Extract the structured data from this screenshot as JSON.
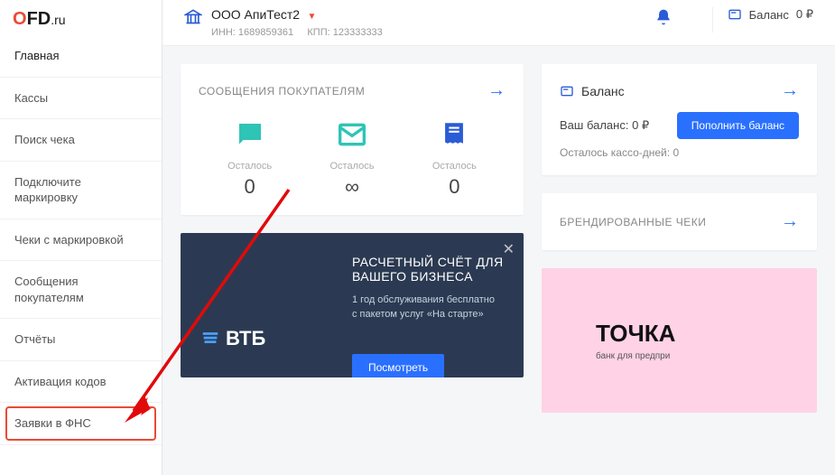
{
  "logo": {
    "text": "OFD",
    "suffix": ".ru"
  },
  "sidebar": {
    "items": [
      {
        "label": "Главная"
      },
      {
        "label": "Кассы"
      },
      {
        "label": "Поиск чека"
      },
      {
        "label": "Подключите маркировку"
      },
      {
        "label": "Чеки с маркировкой"
      },
      {
        "label": "Сообщения покупателям"
      },
      {
        "label": "Отчёты"
      },
      {
        "label": "Активация кодов"
      },
      {
        "label": "Заявки в ФНС"
      }
    ]
  },
  "header": {
    "org_name": "ООО АпиТест2",
    "inn_label": "ИНН:",
    "inn": "1689859361",
    "kpp_label": "КПП:",
    "kpp": "123333333",
    "balance_label": "Баланс",
    "balance_value": "0 ₽"
  },
  "messages_card": {
    "title": "СООБЩЕНИЯ ПОКУПАТЕЛЯМ",
    "items": [
      {
        "label": "Осталось",
        "value": "0"
      },
      {
        "label": "Осталось",
        "value": "∞"
      },
      {
        "label": "Осталось",
        "value": "0"
      }
    ]
  },
  "balance_card": {
    "title": "Баланс",
    "your_balance_label": "Ваш баланс:",
    "your_balance_value": "0 ₽",
    "days_label": "Осталось кассо-дней:",
    "days_value": "0",
    "button": "Пополнить баланс"
  },
  "branded_card": {
    "title": "БРЕНДИРОВАННЫЕ ЧЕКИ"
  },
  "promo_vtb": {
    "title": "РАСЧЕТНЫЙ СЧЁТ ДЛЯ ВАШЕГО БИЗНЕСА",
    "line1": "1 год обслуживания бесплатно",
    "line2": "с пакетом услуг «На старте»",
    "brand": "ВТБ",
    "button": "Посмотреть"
  },
  "promo_tochka": {
    "brand": "ТОЧКА",
    "sub": "банк для предпри"
  }
}
